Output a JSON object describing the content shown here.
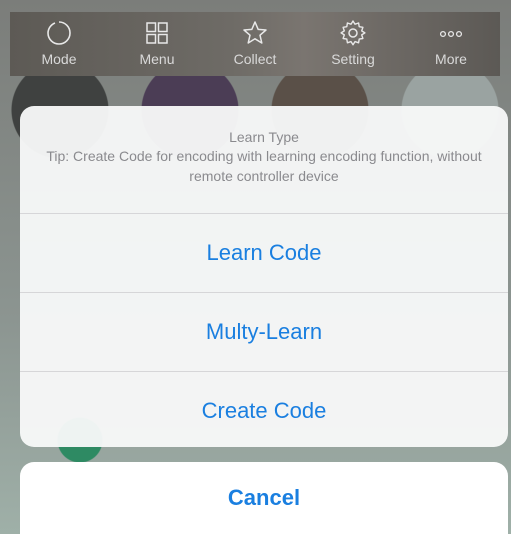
{
  "toolbar": {
    "items": [
      {
        "label": "Mode",
        "icon": "mode-icon"
      },
      {
        "label": "Menu",
        "icon": "menu-grid-icon"
      },
      {
        "label": "Collect",
        "icon": "star-icon"
      },
      {
        "label": "Setting",
        "icon": "gear-icon"
      },
      {
        "label": "More",
        "icon": "more-dots-icon"
      }
    ]
  },
  "sheet": {
    "title": "Learn Type",
    "tip": "Tip: Create Code for encoding with learning encoding function, without remote controller device",
    "options": [
      {
        "label": "Learn Code"
      },
      {
        "label": "Multy-Learn"
      },
      {
        "label": "Create Code"
      }
    ],
    "cancel_label": "Cancel"
  },
  "colors": {
    "accent": "#1a7fe0",
    "sheet_bg": "#f7f8f8",
    "muted_text": "#8a8a8e"
  }
}
